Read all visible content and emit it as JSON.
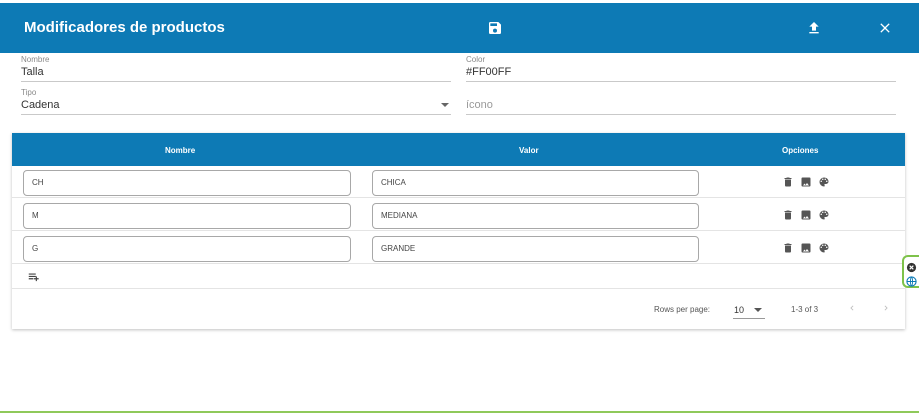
{
  "header": {
    "title": "Modificadores de productos",
    "save_icon": "save-icon",
    "upload_icon": "upload-icon",
    "close_icon": "close-icon"
  },
  "form": {
    "nombre": {
      "label": "Nombre",
      "value": "Talla"
    },
    "color": {
      "label": "Color",
      "value": "#FF00FF"
    },
    "tipo": {
      "label": "Tipo",
      "value": "Cadena"
    },
    "icono": {
      "placeholder": "ícono"
    }
  },
  "table": {
    "columns": [
      "Nombre",
      "Valor",
      "Opciones"
    ],
    "rows": [
      {
        "nombre": "CH",
        "valor": "CHICA"
      },
      {
        "nombre": "M",
        "valor": "MEDIANA"
      },
      {
        "nombre": "G",
        "valor": "GRANDE"
      }
    ],
    "row_option_icons": [
      "delete-icon",
      "image-icon",
      "palette-icon"
    ],
    "add_row_icon": "playlist-add-icon"
  },
  "pagination": {
    "rows_per_page_label": "Rows per page:",
    "rows_per_page_value": "10",
    "range": "1-3 of 3"
  },
  "colors": {
    "primary": "#0d7ab5",
    "accent_green": "#7ec24a"
  }
}
